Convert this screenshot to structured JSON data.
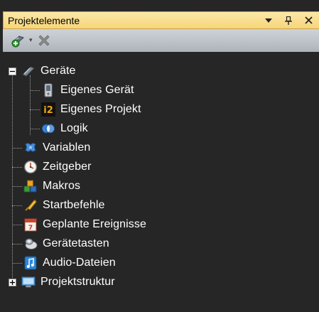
{
  "panel": {
    "title": "Projektelemente",
    "buttons": {
      "dropdown": "▾",
      "pin": "ᵽ",
      "close": "×"
    }
  },
  "toolbar": {
    "add_icon": "add-device-icon",
    "delete_icon": "delete-icon"
  },
  "tree": {
    "root": {
      "label": "Geräte",
      "icon": "devices-icon",
      "expander": "−"
    },
    "children": [
      {
        "label": "Eigenes Gerät",
        "icon": "device-icon"
      },
      {
        "label": "Eigenes Projekt",
        "icon": "i2-project-icon",
        "icon_text": "i2"
      },
      {
        "label": "Logik",
        "icon": "logic-icon"
      }
    ],
    "items": [
      {
        "label": "Variablen",
        "icon": "variables-icon"
      },
      {
        "label": "Zeitgeber",
        "icon": "timer-icon"
      },
      {
        "label": "Makros",
        "icon": "macros-icon"
      },
      {
        "label": "Startbefehle",
        "icon": "startup-commands-icon"
      },
      {
        "label": "Geplante Ereignisse",
        "icon": "scheduled-events-icon"
      },
      {
        "label": "Gerätetasten",
        "icon": "device-keys-icon"
      },
      {
        "label": "Audio-Dateien",
        "icon": "audio-files-icon"
      }
    ],
    "last": {
      "label": "Projektstruktur",
      "icon": "project-structure-icon",
      "expander": "+"
    }
  }
}
